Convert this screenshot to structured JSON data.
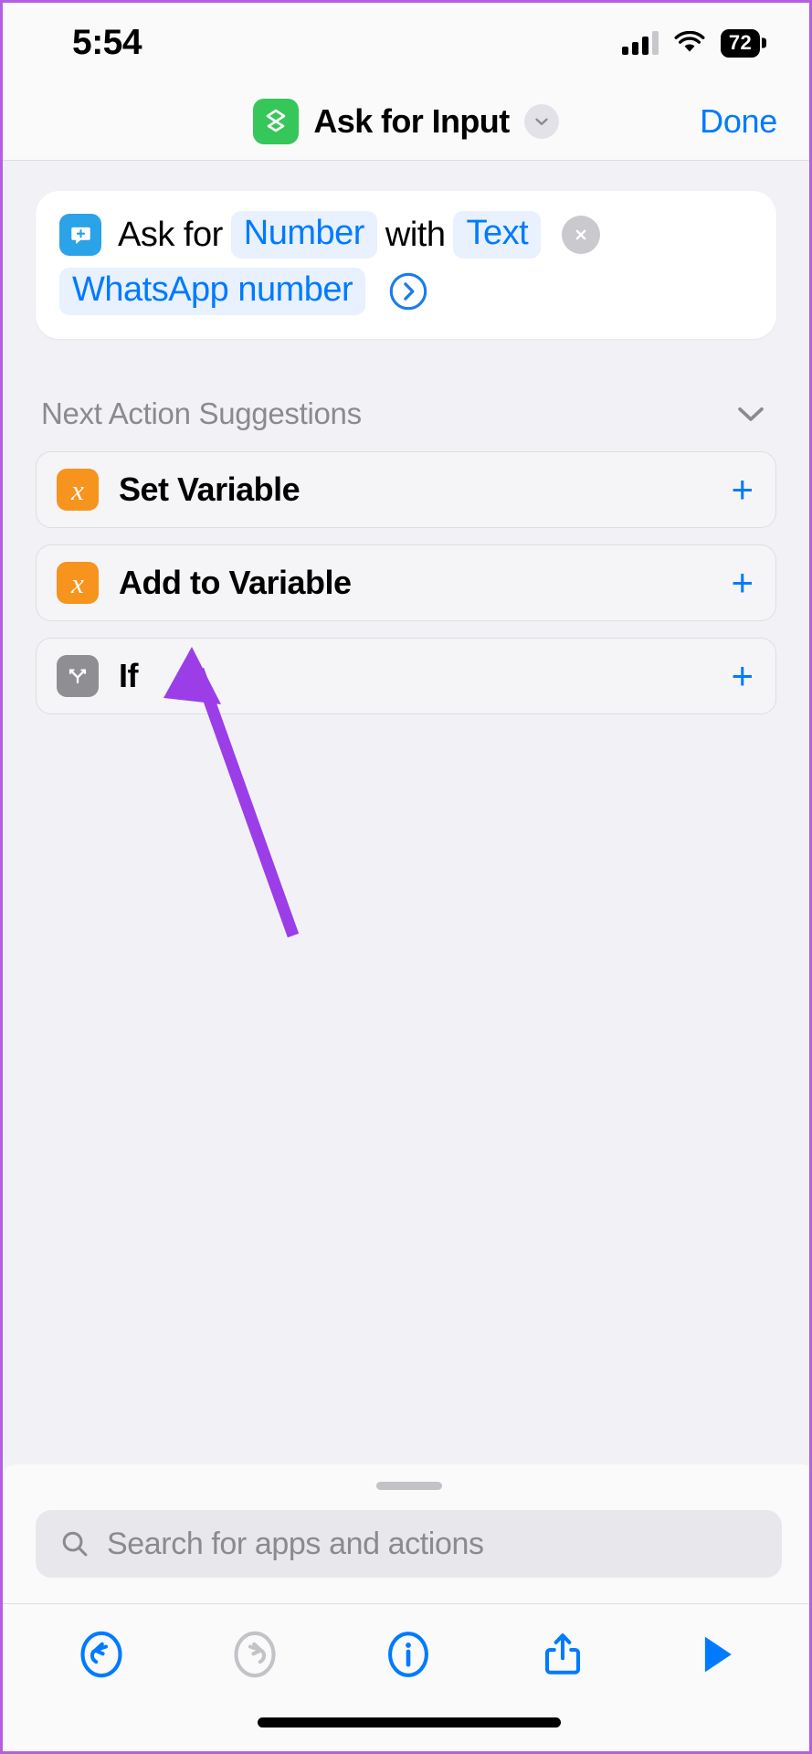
{
  "status_bar": {
    "time": "5:54",
    "cellular_icon": "cellular-signal-icon",
    "wifi_icon": "wifi-icon",
    "battery_level": "72"
  },
  "nav_bar": {
    "app_icon": "shortcuts-icon",
    "title": "Ask for Input",
    "expand_icon": "chevron-down-icon",
    "done_label": "Done"
  },
  "action_card": {
    "icon": "ask-for-input-icon",
    "prefix": "Ask for",
    "input_type_token": "Number",
    "middle": "with",
    "prompt_type_token": "Text",
    "prompt_value_token": "WhatsApp number",
    "detail_icon": "chevron-right-circle-icon",
    "remove_icon": "close-icon"
  },
  "suggestions_section": {
    "title": "Next Action Suggestions",
    "collapse_icon": "chevron-down-icon",
    "items": [
      {
        "icon": "variable-x-icon",
        "icon_glyph": "x",
        "icon_color": "#f7941e",
        "label": "Set Variable",
        "add_icon": "plus-icon"
      },
      {
        "icon": "variable-x-icon",
        "icon_glyph": "x",
        "icon_color": "#f7941e",
        "label": "Add to Variable",
        "add_icon": "plus-icon"
      },
      {
        "icon": "branch-if-icon",
        "icon_glyph": "",
        "icon_color": "#8e8e93",
        "label": "If",
        "add_icon": "plus-icon"
      }
    ]
  },
  "bottom_sheet": {
    "grabber": "sheet-grabber",
    "search_placeholder": "Search for apps and actions",
    "search_value": "",
    "search_icon": "search-icon",
    "toolbar": [
      {
        "name": "undo-button",
        "icon": "undo-icon",
        "enabled": true
      },
      {
        "name": "redo-button",
        "icon": "redo-icon",
        "enabled": false
      },
      {
        "name": "info-button",
        "icon": "info-circle-icon",
        "enabled": true
      },
      {
        "name": "share-button",
        "icon": "share-icon",
        "enabled": true
      },
      {
        "name": "run-button",
        "icon": "play-icon",
        "enabled": true
      }
    ]
  },
  "annotation": {
    "type": "arrow",
    "color": "#9b3ee8",
    "points_to": "Set Variable"
  },
  "colors": {
    "accent_blue": "#007aff",
    "shortcut_green": "#35c759",
    "ask_blue": "#2aa3e8",
    "variable_orange": "#f7941e",
    "if_gray": "#8e8e93",
    "background": "#f2f1f6",
    "annotation_purple": "#9b3ee8"
  }
}
